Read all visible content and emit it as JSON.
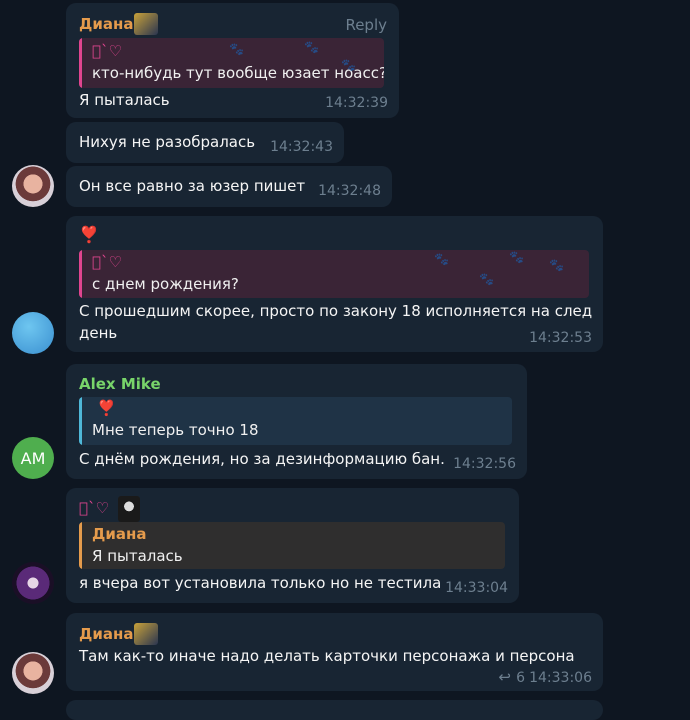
{
  "colors": {
    "background": "#0e1621",
    "bubble": "#182533",
    "diana_name": "#e59b4c",
    "alex_name": "#78d46a",
    "quote_pink": "#e0458f",
    "quote_teal": "#4fb8d8",
    "time_gray": "#6d7f8f"
  },
  "messages": [
    {
      "sender": "Диана",
      "reply_label": "Reply",
      "quote_author": "\u0000`♡",
      "quote_text": "кто-нибудь тут вообще юзает ноасс?",
      "text": "Я пыталась",
      "time": "14:32:39"
    },
    {
      "text": "Нихуя не разобралась",
      "time": "14:32:43"
    },
    {
      "text": "Он все равно за юзер пишет",
      "time": "14:32:48"
    },
    {
      "emoji": "❣️",
      "quote_author": "\u0000`♡",
      "quote_text": "с днем рождения?",
      "text_line1": "С прошедшим скорее, просто по закону 18 исполняется на след",
      "text_line2": "день",
      "time": "14:32:53"
    },
    {
      "sender": "Alex Mike",
      "quote_emoji": "❣️",
      "quote_text": "Мне теперь точно 18",
      "text": "С днём рождения, но за дезинформацию бан.",
      "time": "14:32:56"
    },
    {
      "sender": "\u0000`♡",
      "quote_author": "Диана",
      "quote_text": "Я пыталась",
      "text": "я вчера вот установила только но не тестила",
      "time": "14:33:04"
    },
    {
      "sender": "Диана",
      "text": "Там как-то иначе надо делать карточки персонажа и персона",
      "replies_count": "6",
      "time": "14:33:06"
    }
  ],
  "avatars": {
    "alex_initials": "AM"
  }
}
